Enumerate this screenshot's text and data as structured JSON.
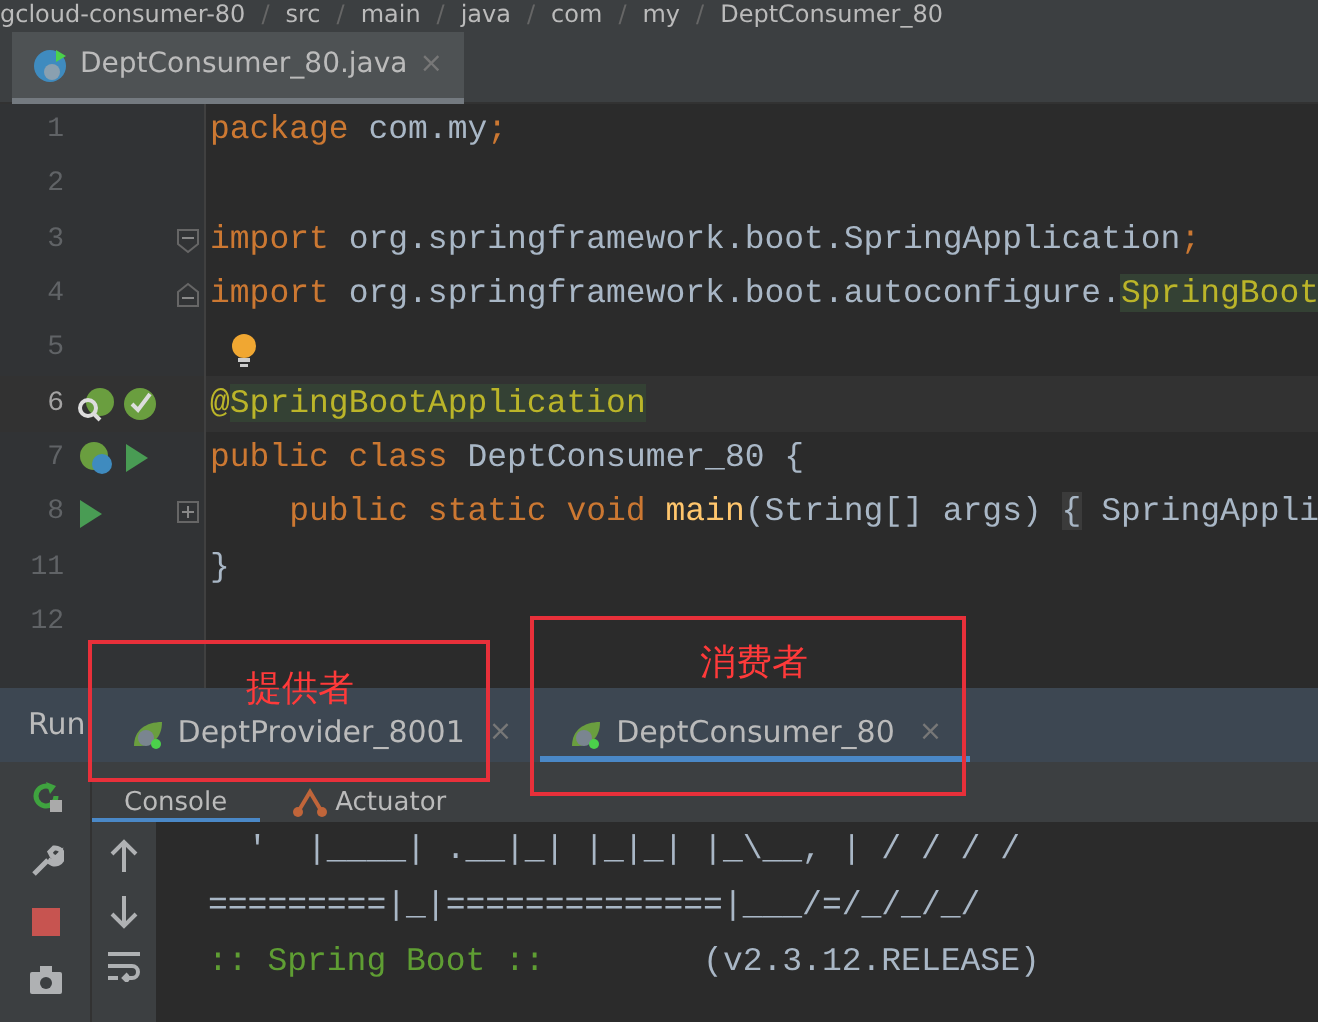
{
  "breadcrumb": [
    {
      "label": "gcloud-consumer-80"
    },
    {
      "separator": "/",
      "label": "src"
    },
    {
      "separator": "/",
      "label": "main"
    },
    {
      "separator": "/",
      "label": "java"
    },
    {
      "separator": "/",
      "label": "com"
    },
    {
      "separator": "/",
      "label": "my"
    },
    {
      "separator": "/",
      "label": "DeptConsumer_80"
    }
  ],
  "editor_tabs": [
    {
      "label": "DeptConsumer_80.java",
      "close": "×",
      "selected": true
    }
  ],
  "code_lines": [
    {
      "number": "1",
      "current": false,
      "tokens": [
        {
          "text": "package ",
          "kind": "keyword"
        },
        {
          "text": "com.my",
          "kind": "plain"
        },
        {
          "text": ";",
          "kind": "keyword"
        }
      ]
    },
    {
      "number": "2",
      "current": false
    },
    {
      "number": "3",
      "current": false,
      "fold": {
        "kind": "start"
      },
      "tokens": [
        {
          "text": "import ",
          "kind": "keyword"
        },
        {
          "text": "org.springframework.boot.SpringApplication",
          "kind": "plain"
        },
        {
          "text": ";",
          "kind": "keyword"
        }
      ]
    },
    {
      "number": "4",
      "current": false,
      "fold": {
        "kind": "end"
      },
      "tokens": [
        {
          "text": "import ",
          "kind": "keyword"
        },
        {
          "text": "org.springframework.boot.autoconfigure.",
          "kind": "plain"
        },
        {
          "text": "SpringBoot",
          "kind": "annotation-mark"
        }
      ]
    },
    {
      "number": "5",
      "current": false,
      "bulb": true
    },
    {
      "number": "6",
      "current": true,
      "gutter": [
        {
          "kind": "search-leaf"
        },
        {
          "kind": "leaf-check"
        }
      ],
      "tokens": [
        {
          "text": "@",
          "kind": "annotation"
        },
        {
          "text": "SpringBootApplication",
          "kind": "annotation-mark"
        }
      ]
    },
    {
      "number": "7",
      "current": false,
      "gutter": [
        {
          "kind": "leaf-bean"
        },
        {
          "kind": "run"
        }
      ],
      "tokens": [
        {
          "text": "public class ",
          "kind": "keyword"
        },
        {
          "text": "DeptConsumer_80 {",
          "kind": "plain"
        }
      ]
    },
    {
      "number": "8",
      "current": false,
      "gutter": [
        {
          "kind": "run"
        }
      ],
      "fold": {
        "kind": "collapsed"
      },
      "tokens": [
        {
          "text": "    public static void ",
          "kind": "keyword"
        },
        {
          "text": "main",
          "kind": "method"
        },
        {
          "text": "(String[] args) ",
          "kind": "plain"
        },
        {
          "text": "{",
          "kind": "folded"
        },
        {
          "text": " SpringAppli",
          "kind": "plain"
        }
      ]
    },
    {
      "number": "11",
      "current": false,
      "tokens": [
        {
          "text": "}",
          "kind": "plain"
        }
      ]
    },
    {
      "number": "12",
      "current": false
    }
  ],
  "run_window": {
    "title": "Run",
    "tabs": [
      {
        "label": "DeptProvider_8001",
        "close": "×",
        "selected": false
      },
      {
        "label": "DeptConsumer_80",
        "close": "×",
        "selected": true
      }
    ],
    "subtabs": [
      {
        "label": "Console",
        "selected": true
      },
      {
        "label": "Actuator",
        "selected": false
      }
    ],
    "console_lines": [
      [
        {
          "text": "  '  |____| .__|_| |_|_| |_\\__, | / / / /",
          "kind": "plain"
        }
      ],
      [
        {
          "text": "=========|_|==============|___/=/_/_/_/",
          "kind": "plain"
        }
      ],
      [
        {
          "text": ":: Spring Boot ::",
          "kind": "green"
        },
        {
          "text": "        (v2.3.12.RELEASE)",
          "kind": "plain"
        }
      ]
    ]
  },
  "annotations": [
    {
      "label": "提供者"
    },
    {
      "label": "消费者"
    }
  ]
}
